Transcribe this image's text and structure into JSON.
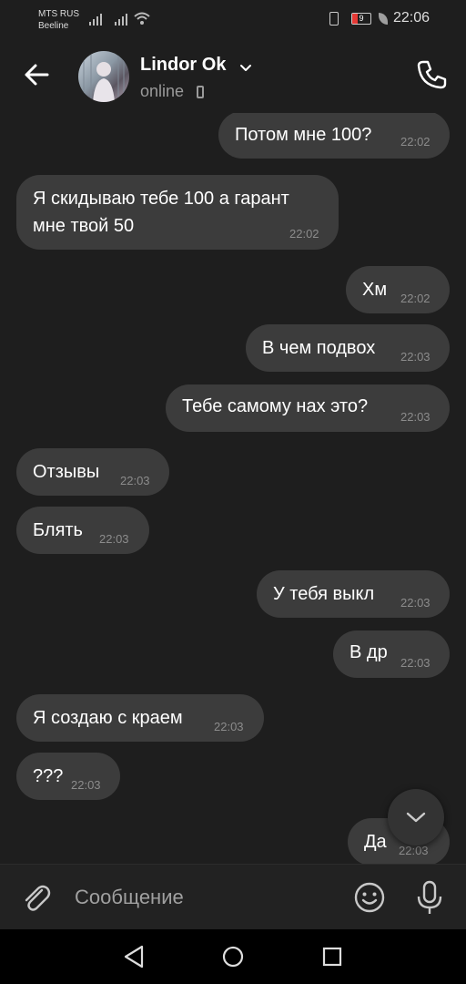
{
  "status_bar": {
    "carrier_1": "MTS RUS",
    "carrier_2": "Beeline",
    "battery": "9",
    "time": "22:06"
  },
  "header": {
    "contact_name": "Lindor Ok",
    "status": "online"
  },
  "messages": [
    {
      "side": "out",
      "text": "Потом мне 100?",
      "time": "22:02"
    },
    {
      "side": "in",
      "text": "Я скидываю тебе 100 а гарант",
      "text2": "мне твой 50",
      "time": "22:02"
    },
    {
      "side": "out",
      "text": "Хм",
      "time": "22:02"
    },
    {
      "side": "out",
      "text": "В чем подвох",
      "time": "22:03"
    },
    {
      "side": "out",
      "text": "Тебе самому нах это?",
      "time": "22:03"
    },
    {
      "side": "in",
      "text": "Отзывы",
      "time": "22:03"
    },
    {
      "side": "in",
      "text": "Блять",
      "time": "22:03"
    },
    {
      "side": "out",
      "text": "У тебя выкл",
      "time": "22:03"
    },
    {
      "side": "out",
      "text": "В др",
      "time": "22:03"
    },
    {
      "side": "in",
      "text": "Я создаю с краем",
      "time": "22:03"
    },
    {
      "side": "in",
      "text": "???",
      "time": "22:03"
    },
    {
      "side": "out",
      "text": "Да",
      "time": "22:03"
    }
  ],
  "composer": {
    "placeholder": "Сообщение"
  },
  "icons": {
    "back": "arrow-left-icon",
    "name_chevron": "chevron-down-icon",
    "call": "phone-icon",
    "scroll_down": "chevron-down-icon",
    "attach": "paperclip-icon",
    "emoji": "smiley-icon",
    "mic": "microphone-icon",
    "nav_back": "triangle-back-icon",
    "nav_home": "circle-home-icon",
    "nav_recent": "square-recents-icon"
  },
  "colors": {
    "background": "#1e1e1e",
    "bubble": "#3c3c3c",
    "timestamp": "#8c8c8c",
    "battery_low": "#e53935"
  }
}
